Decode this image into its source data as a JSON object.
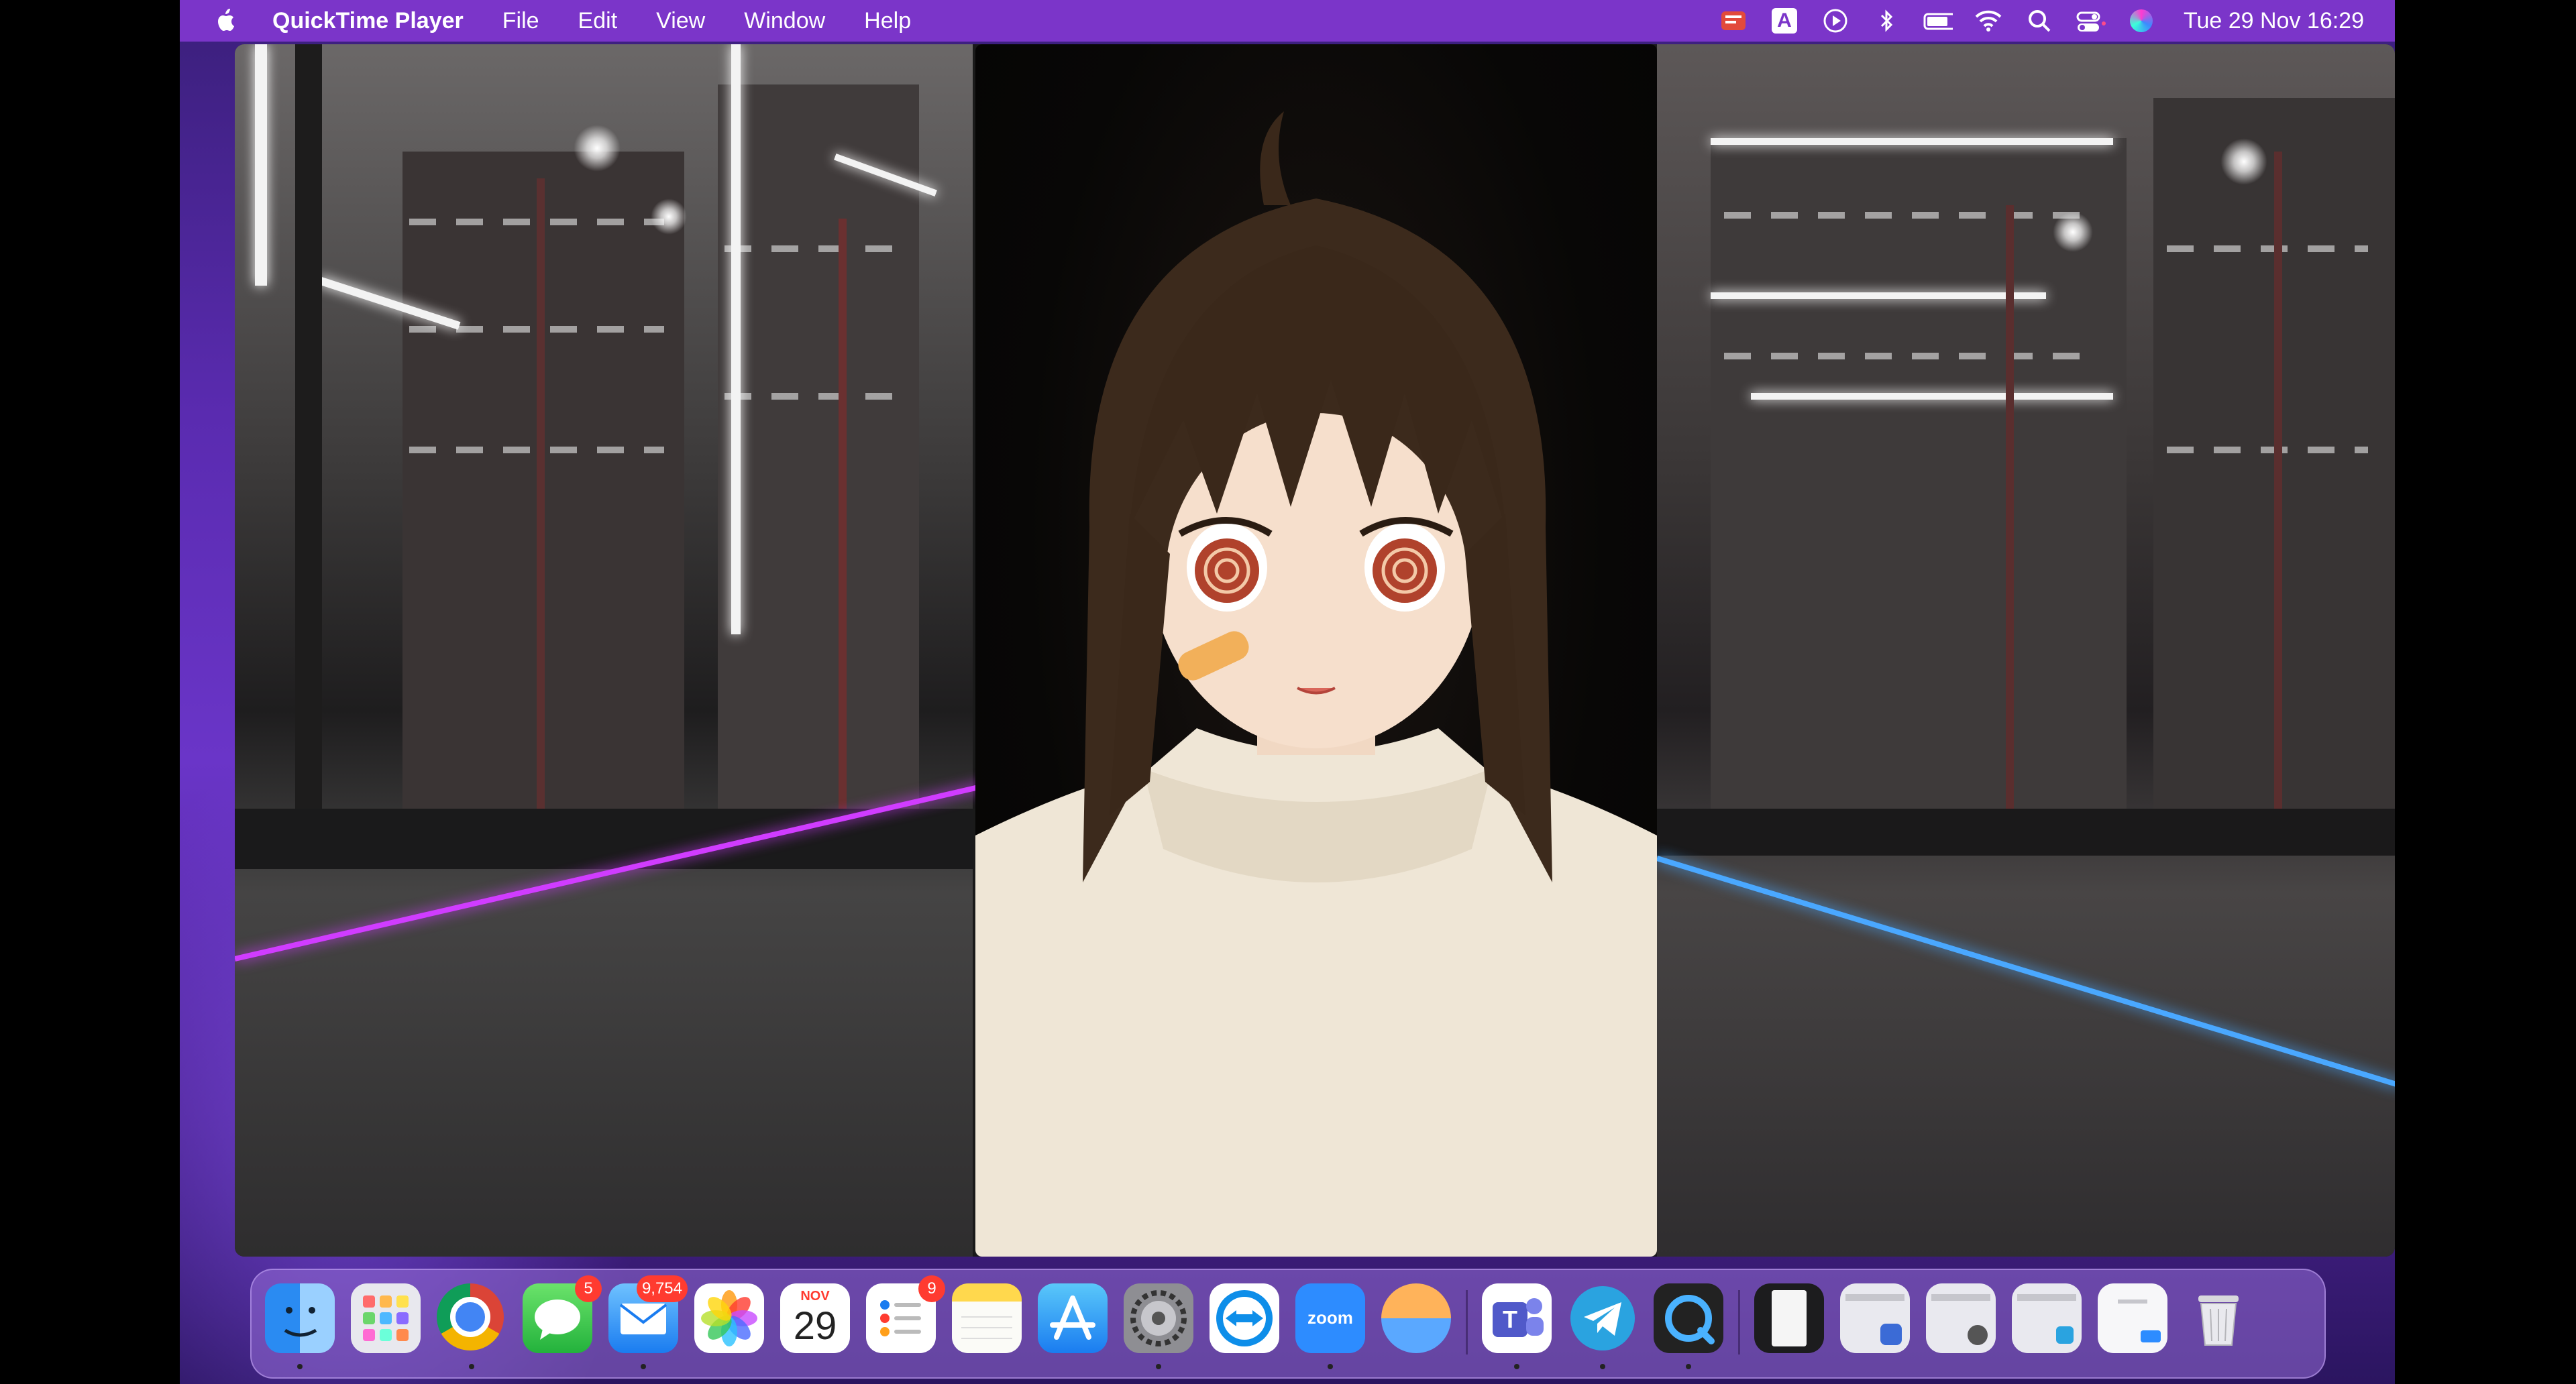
{
  "menubar": {
    "app_name": "QuickTime Player",
    "menus": [
      "File",
      "Edit",
      "View",
      "Window",
      "Help"
    ],
    "status_icons": [
      "pdf-expert-icon",
      "input-source-icon",
      "play-icon",
      "bluetooth-icon",
      "battery-icon",
      "wifi-icon",
      "spotlight-icon",
      "control-center-icon",
      "siri-icon"
    ],
    "input_source_label": "A",
    "clock": "Tue 29 Nov  16:29"
  },
  "video": {
    "description_type": "anime 3D avatar in front of night street scene"
  },
  "dock": {
    "apps": [
      {
        "name": "Finder",
        "icon": "finder-icon",
        "running": true
      },
      {
        "name": "Launchpad",
        "icon": "launchpad-icon",
        "running": false
      },
      {
        "name": "Google Chrome",
        "icon": "chrome-icon",
        "running": true
      },
      {
        "name": "Messages",
        "icon": "messages-icon",
        "running": false,
        "badge": "5"
      },
      {
        "name": "Mail",
        "icon": "mail-icon",
        "running": true,
        "badge": "9,754"
      },
      {
        "name": "Photos",
        "icon": "photos-icon",
        "running": false
      },
      {
        "name": "Calendar",
        "icon": "calendar-icon",
        "running": false,
        "month": "NOV",
        "day": "29"
      },
      {
        "name": "Reminders",
        "icon": "reminders-icon",
        "running": false,
        "badge": "9"
      },
      {
        "name": "Notes",
        "icon": "notes-icon",
        "running": false
      },
      {
        "name": "App Store",
        "icon": "app-store-icon",
        "running": false
      },
      {
        "name": "System Preferences",
        "icon": "system-preferences-icon",
        "running": true
      },
      {
        "name": "TeamViewer",
        "icon": "teamviewer-icon",
        "running": false
      },
      {
        "name": "Zoom",
        "icon": "zoom-icon",
        "running": true,
        "label": "zoom"
      },
      {
        "name": "Backup",
        "icon": "backup-icon",
        "running": false
      },
      {
        "name": "Microsoft Teams",
        "icon": "teams-icon",
        "running": true
      },
      {
        "name": "Telegram",
        "icon": "telegram-icon",
        "running": true
      },
      {
        "name": "QuickTime Player",
        "icon": "quicktime-icon",
        "running": true
      }
    ],
    "minimized": [
      "minimized-window-1",
      "minimized-window-2",
      "minimized-window-3",
      "minimized-window-4",
      "minimized-window-5"
    ],
    "trash": {
      "name": "Trash",
      "icon": "trash-icon"
    }
  },
  "colors": {
    "menubar": "#7b35c9",
    "badge": "#ff3b30",
    "neon_pink": "#d03cff",
    "neon_blue": "#4aa8ff"
  }
}
